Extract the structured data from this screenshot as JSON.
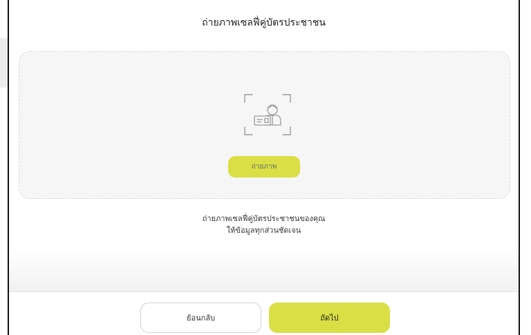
{
  "page": {
    "title": "ถ่ายภาพเซลฟี่คู่บัตรประชาชน"
  },
  "capture": {
    "icon": "id-card-selfie-icon",
    "button_label": "ถ่ายภาพ"
  },
  "instructions": {
    "line1": "ถ่ายภาพเซลฟี่คู่บัตรประชาชนของคุณ",
    "line2": "ให้ข้อมูลทุกส่วนชัดเจน"
  },
  "footer": {
    "back_label": "ย้อนกลับ",
    "next_label": "ถัดไป"
  },
  "colors": {
    "accent": "#d9df44",
    "card_background": "#f6f6f6",
    "icon_gray": "#9a9a9a"
  }
}
